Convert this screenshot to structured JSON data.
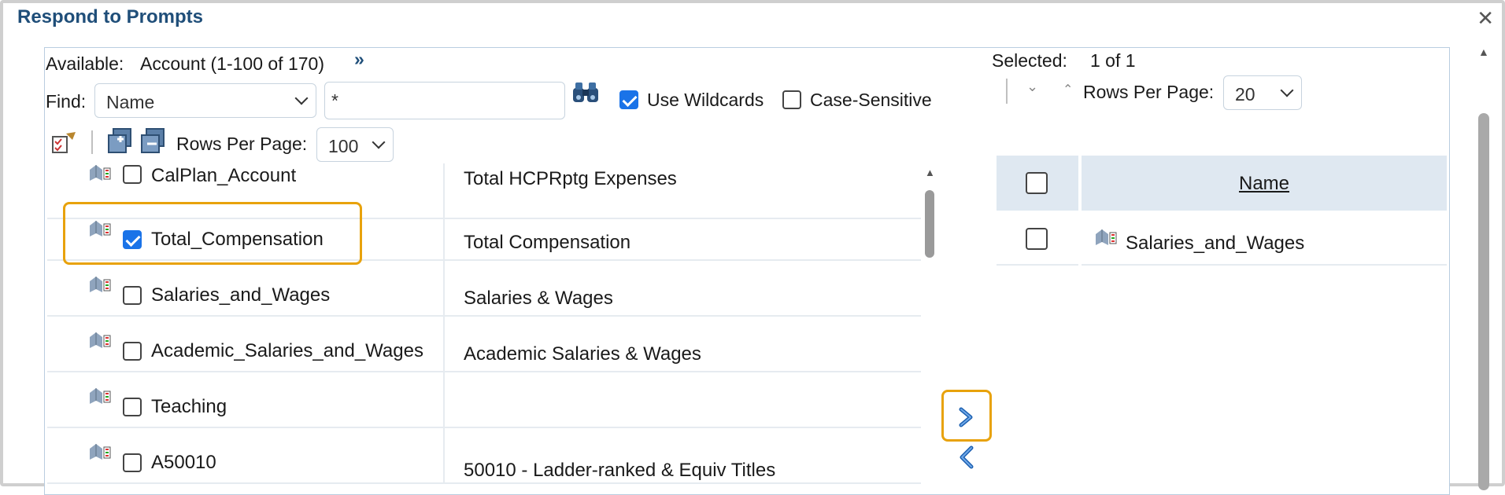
{
  "dialog": {
    "title": "Respond to Prompts"
  },
  "available": {
    "label": "Available:",
    "dimension": "Account (1-100 of 170)",
    "find_label": "Find:",
    "find_field": "Name",
    "find_value": "*",
    "use_wildcards_label": "Use Wildcards",
    "use_wildcards_checked": true,
    "case_sensitive_label": "Case-Sensitive",
    "case_sensitive_checked": false,
    "rows_per_page_label": "Rows Per Page:",
    "rows_per_page_value": "100",
    "rows": [
      {
        "name": "CalPlan_Account",
        "description": "Total HCPRptg Expenses",
        "checked": false
      },
      {
        "name": "Total_Compensation",
        "description": "Total Compensation",
        "checked": true
      },
      {
        "name": "Salaries_and_Wages",
        "description": "Salaries & Wages",
        "checked": false
      },
      {
        "name": "Academic_Salaries_and_Wages",
        "description": "Academic Salaries & Wages",
        "checked": false
      },
      {
        "name": "Teaching",
        "description": "",
        "checked": false
      },
      {
        "name": "A50010",
        "description": "50010 - Ladder-ranked & Equiv Titles",
        "checked": false
      }
    ]
  },
  "selected": {
    "label": "Selected:",
    "count": "1 of 1",
    "rows_per_page_label": "Rows Per Page:",
    "rows_per_page_value": "20",
    "column_header": "Name",
    "rows": [
      {
        "name": "Salaries_and_Wages",
        "checked": false
      }
    ]
  },
  "icons": {
    "double_chevron": "double-chevron-right-icon",
    "search": "binoculars-icon",
    "member": "member-icon",
    "select_all": "select-members-icon",
    "move_right": "move-right-icon",
    "move_left": "move-left-icon"
  },
  "colors": {
    "accent": "#1a73e8",
    "highlight": "#e8a20c",
    "title": "#1f4e79",
    "header_bg": "#dfe8f1"
  }
}
